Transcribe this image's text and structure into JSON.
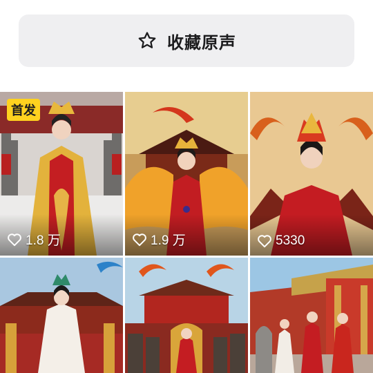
{
  "collect_button": {
    "label": "收藏原声",
    "icon": "star-outline-icon"
  },
  "colors": {
    "button_bg": "#efeff1",
    "badge_bg": "#ffd21f",
    "accent_red": "#b81c1c",
    "gold": "#e0b040"
  },
  "videos": [
    {
      "badge": "首发",
      "likes": "1.8 万",
      "scene": "empress-in-snow"
    },
    {
      "likes": "1.9 万",
      "scene": "phoenix-wings-woman"
    },
    {
      "likes": "5330",
      "scene": "woman-with-phoenixes"
    },
    {
      "scene": "white-robed-empress-palace"
    },
    {
      "scene": "palace-gate-soldiers"
    },
    {
      "scene": "royal-couple-red-wall"
    }
  ]
}
